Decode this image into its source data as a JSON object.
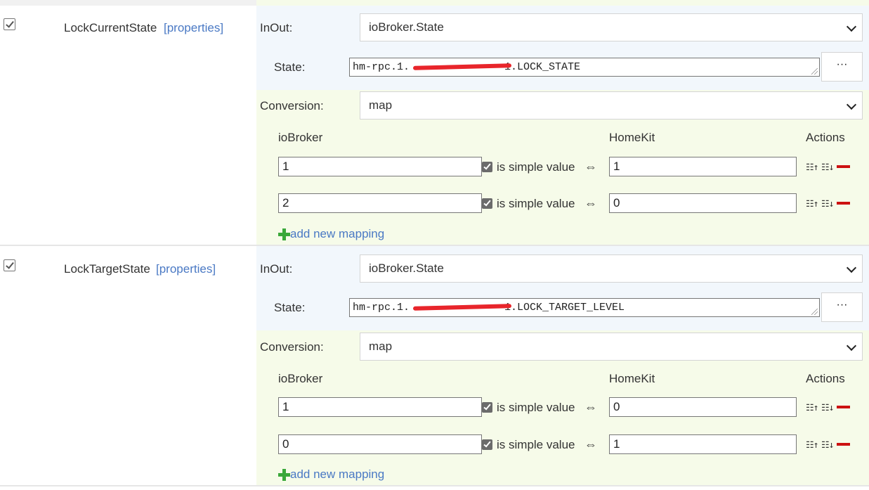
{
  "rows": [
    {
      "name": "LockCurrentState",
      "props_label": "[properties]",
      "inout_label": "InOut:",
      "inout_value": "ioBroker.State",
      "state_label": "State:",
      "state_value_prefix": "hm-rpc.1.",
      "state_value_suffix": "1.LOCK_STATE",
      "dots_label": "···",
      "conversion_label": "Conversion:",
      "conversion_value": "map",
      "col_iobroker": "ioBroker",
      "col_homekit": "HomeKit",
      "col_actions": "Actions",
      "mappings": [
        {
          "iobroker": "1",
          "simple": "is simple value",
          "homekit": "1"
        },
        {
          "iobroker": "2",
          "simple": "is simple value",
          "homekit": "0"
        }
      ],
      "add_label": "add new mapping"
    },
    {
      "name": "LockTargetState",
      "props_label": "[properties]",
      "inout_label": "InOut:",
      "inout_value": "ioBroker.State",
      "state_label": "State:",
      "state_value_prefix": "hm-rpc.1.",
      "state_value_suffix": "1.LOCK_TARGET_LEVEL",
      "dots_label": "···",
      "conversion_label": "Conversion:",
      "conversion_value": "map",
      "col_iobroker": "ioBroker",
      "col_homekit": "HomeKit",
      "col_actions": "Actions",
      "mappings": [
        {
          "iobroker": "1",
          "simple": "is simple value",
          "homekit": "0"
        },
        {
          "iobroker": "0",
          "simple": "is simple value",
          "homekit": "1"
        }
      ],
      "add_label": "add new mapping"
    }
  ],
  "icons": {
    "equiv": "⇔",
    "sort_up": "☷↑",
    "sort_down": "☷↓"
  },
  "colors": {
    "link": "#4a79c4",
    "remove": "#cc1111",
    "add": "#3aa83a",
    "redaction": "#e8252b"
  }
}
